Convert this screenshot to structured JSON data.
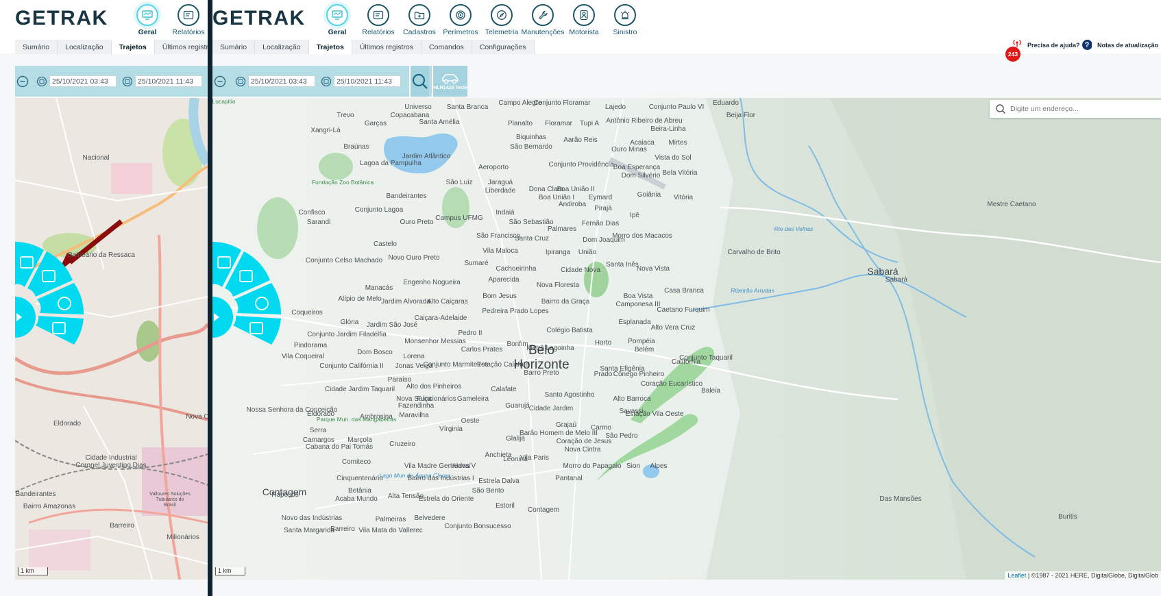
{
  "app": {
    "brand": "GETRAK"
  },
  "nav": {
    "items_main": [
      {
        "label": "Geral",
        "icon": "monitor-icon",
        "active": true
      },
      {
        "label": "Relatórios",
        "icon": "report-icon"
      },
      {
        "label": "Cadastros",
        "icon": "folder-plus-icon"
      },
      {
        "label": "Perímetros",
        "icon": "target-icon"
      },
      {
        "label": "Telemetria",
        "icon": "compass-icon"
      },
      {
        "label": "Manutenções",
        "icon": "wrench-icon"
      },
      {
        "label": "Motorista",
        "icon": "driver-icon"
      },
      {
        "label": "Sinistro",
        "icon": "siren-icon"
      }
    ],
    "items_left": [
      {
        "label": "Geral",
        "active": true
      },
      {
        "label": "Relatórios"
      }
    ]
  },
  "subtabs": {
    "main": [
      "Sumário",
      "Localização",
      "Trajetos",
      "Últimos registros",
      "Comandos",
      "Configurações"
    ],
    "left": [
      "Sumário",
      "Localização",
      "Trajetos",
      "Últimos registros"
    ],
    "active": "Trajetos"
  },
  "toolbar": {
    "date_start": "25/10/2021 03:43",
    "date_end": "25/10/2021 11:43",
    "vehicle_label": "HLH1428 Teste"
  },
  "header": {
    "notification_count": "243",
    "help_label": "Precisa de ajuda?",
    "help_mark": "?",
    "notes_label": "Notas de atualização"
  },
  "map": {
    "search_placeholder": "Digite um endereço...",
    "scale_label": "1 km",
    "attribution_link": "Leaflet",
    "attribution_text": " | ©1987 - 2021 HERE, DigitalGlobe, DigitalGlob",
    "labels_main": [
      "Universo",
      "Copacabana",
      "Santa Amélia",
      "Santa Branca",
      "Campo Alegre",
      "Conjunto Floramar",
      "Lajedo",
      "Conjunto Paulo VI",
      "Eduardo",
      "Beija Flor",
      "Trevo",
      "Garças",
      "Xangri-Lá",
      "Braúnas",
      "Jardim Atlântico",
      "Biquinhas",
      "São Bernardo",
      "Planalto",
      "Floramar",
      "Tupi A",
      "Aarão Reis",
      "Antônio Ribeiro de Abreu",
      "Beira-Linha",
      "Acaiaca",
      "Mirtes",
      "Ouro Minas",
      "Vista do Sol",
      "Lagoa da Pampulha",
      "Aeroporto",
      "Conjunto Providência",
      "Boa Esperança",
      "Dom Silvério",
      "Bela Vitória",
      "Fundação Zoo Botânica",
      "São Luiz",
      "Jaraguá",
      "Liberdade",
      "Dona Clara",
      "Boa União II",
      "Boa União I",
      "Eymard",
      "Goiânia",
      "Vitória",
      "Bandeirantes",
      "Confisco",
      "Sarandi",
      "Conjunto Lagoa",
      "Ouro Preto",
      "Campus UFMG",
      "Indaiá",
      "São Sebastião",
      "Andiroba",
      "Pirajá",
      "Ipê",
      "Palmares",
      "Fernão Dias",
      "Mestre Caetano",
      "São Francisco",
      "Santa Cruz",
      "Dom Joaquim",
      "Morro dos Macacos",
      "Rio das Velhas",
      "Castelo",
      "Vila Maloca",
      "Ipiranga",
      "União",
      "Carvalho de Brito",
      "Novo Ouro Preto",
      "Sumaré",
      "Cachoeirinha",
      "Cidade Nova",
      "Santa Inês",
      "Nova Vista",
      "Conjunto Celso Machado",
      "Engenho Nogueira",
      "Aparecida",
      "Manacás",
      "Nova Floresta",
      "Sabará",
      "Ribeirão Arrudas",
      "Casa Branca",
      "Alípio de Melo",
      "Jardim Alvorada",
      "Alto Caiçaras",
      "Bom Jesus",
      "Bairro da Graça",
      "Boa Vista",
      "Camponesa III",
      "Caetano Furquim",
      "Coqueiros",
      "Glória",
      "Pedreira Prado Lopes",
      "Esplanada",
      "Caiçara-Adelaide",
      "Jardim São José",
      "Alto Vera Cruz",
      "Conjunto Jardim Filadélfia",
      "Pedro II",
      "Colégio Batista",
      "Monsenhor Messias",
      "Bonfim",
      "Horto",
      "Pompéia",
      "Belém",
      "Pindorama",
      "Vila Coqueiral",
      "Carlos Prates",
      "Dom Bosco",
      "Lorena",
      "Metrô Lagoinha",
      "Conjunto Taquaril",
      "Conjunto Califórnia II",
      "Califórnia",
      "Jonas Veiga",
      "Conjunto Marmiteiros",
      "Estação Calafate",
      "Barro Preto",
      "Prado",
      "Santa Efigênia",
      "Cônego Pinheiro",
      "Paraíso",
      "Coração Eucarístico",
      "Baleia",
      "Cidade Jardim Taquaril",
      "Alto dos Pinheiros",
      "Calafate",
      "Santo Agostinho",
      "Funcionários",
      "Nova Suíça",
      "Gameleira",
      "Alto Barroca",
      "Fazendinha",
      "Guarujá",
      "Cidade Jardim",
      "Savassi",
      "Nossa Senhora da Conceição",
      "Eldorado",
      "Maravilha",
      "Ambrosina",
      "Estação Vila Oeste",
      "Parque Mun. das Mangabeiras",
      "Oeste",
      "Grajaú",
      "Carmo",
      "Serra",
      "Camargos",
      "Vírginia",
      "Barão Homem de Melo III",
      "São Pedro",
      "Marçola",
      "Cabana do Pai Tomás",
      "Glalijá",
      "Coração de Jesus",
      "Cruzeiro",
      "Nova Cintra",
      "Anchieta",
      "Leonina",
      "Vila Paris",
      "Morro do Papagaio",
      "Sion",
      "Comiteco",
      "Vila Madre Gertrudes V",
      "Havaí",
      "Alpes",
      "Lago Mun de Águas Claras",
      "Cinquentenário",
      "Bairro das Indústrias I",
      "Betânia",
      "Pantanal",
      "Acaba Mundo",
      "Alta Tensão",
      "Estrela do Oriente",
      "Estrela Dalva",
      "São Bento",
      "Estoril",
      "Das Mansões",
      "Raposos",
      "Contagem",
      "Belvedere",
      "Palmeiras",
      "Novo das Indústrias",
      "Santa Margarida",
      "Barreiro",
      "Vila Mata do Vallerec",
      "Conjunto Bonsucesso",
      "Buritis",
      "Mata de Lucapitio"
    ],
    "labels_big": [
      "Belo Horizonte",
      "Contagem",
      "Sabará"
    ],
    "labels_left": [
      "Nacional",
      "Balneário da Ressaca",
      "Eldorado",
      "Nova C",
      "Cidade Industrial Coronel Juventino Dias",
      "Bandeirantes",
      "Bairro Amazonas",
      "Barreiro",
      "Milionários",
      "Vallourec Soluções Tubulares do Brasil"
    ]
  },
  "colors": {
    "accent": "#00d9ef",
    "toolbar": "#b5dde6",
    "divider": "#0e2230",
    "badge": "#e11818",
    "arrow": "#8b0c0c"
  }
}
